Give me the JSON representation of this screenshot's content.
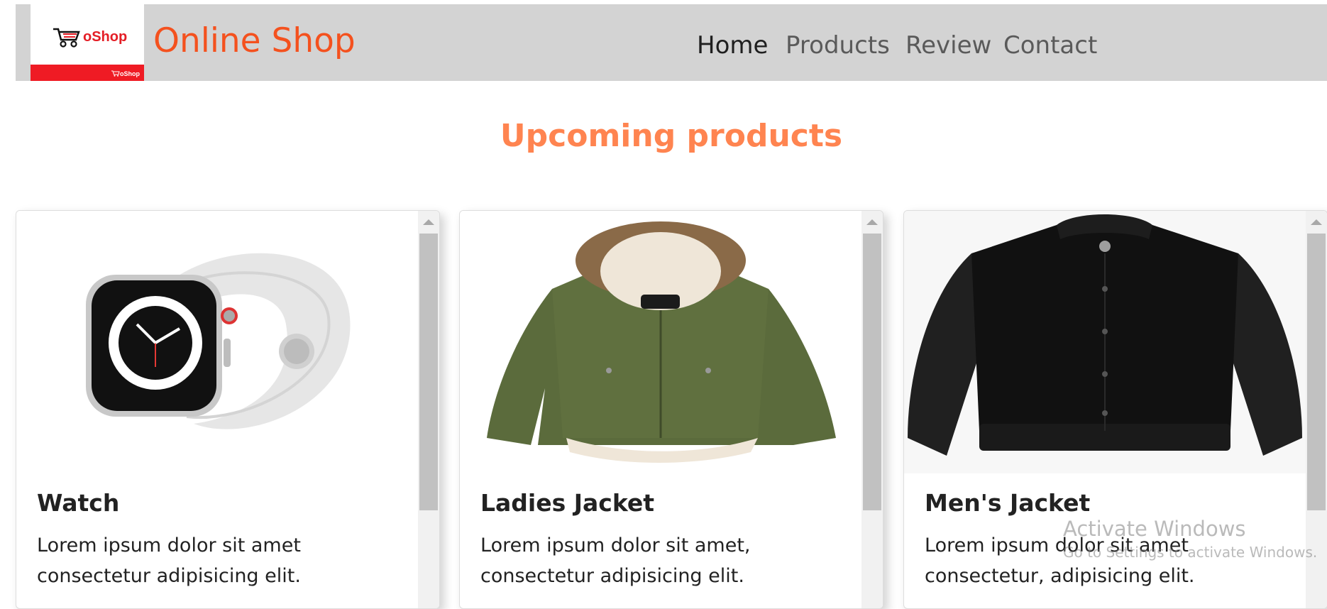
{
  "header": {
    "logo_text": "oShop",
    "logo_small_text": "oShop",
    "brand": "Online Shop",
    "nav": [
      {
        "label": "Home",
        "active": true
      },
      {
        "label": "Products",
        "active": false
      },
      {
        "label": "Review",
        "active": false
      },
      {
        "label": "Contact",
        "active": false
      }
    ]
  },
  "main": {
    "title": "Upcoming products",
    "products": [
      {
        "title": "Watch",
        "text": "Lorem ipsum dolor sit amet consectetur adipisicing elit.",
        "image": "smartwatch-image"
      },
      {
        "title": "Ladies Jacket",
        "text": "Lorem ipsum dolor sit amet, consectetur adipisicing elit.",
        "image": "green-parka-image"
      },
      {
        "title": "Men's Jacket",
        "text": "Lorem ipsum dolor sit amet consectetur, adipisicing elit.",
        "image": "black-bomber-jacket-image"
      }
    ]
  },
  "watermark": {
    "line1": "Activate Windows",
    "line2": "Go to Settings to activate Windows."
  },
  "colors": {
    "brand": "#f4511e",
    "title": "#ff8450",
    "navbar_bg": "#d3d3d3",
    "logo_red": "#ef1b24"
  }
}
